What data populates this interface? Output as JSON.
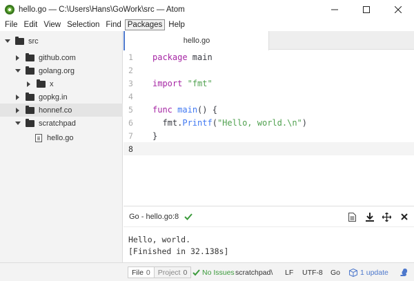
{
  "window": {
    "title": "hello.go — C:\\Users\\Hans\\GoWork\\src — Atom",
    "minimize_label": "—",
    "maximize_label": "☐",
    "close_label": "✕"
  },
  "menu": [
    "File",
    "Edit",
    "View",
    "Selection",
    "Find",
    "Packages",
    "Help"
  ],
  "tree": {
    "root": "src",
    "items": [
      "github.com",
      "golang.org",
      "x",
      "gopkg.in",
      "honnef.co",
      "scratchpad",
      "hello.go"
    ]
  },
  "editor": {
    "tab_label": "hello.go",
    "line_numbers": [
      "1",
      "2",
      "3",
      "4",
      "5",
      "6",
      "7",
      "8"
    ],
    "code": {
      "l1_kw": "package",
      "l1_rest": " main",
      "l3_kw": "import",
      "l3_str": "\"fmt\"",
      "l5_kw": "func",
      "l5_fn": "main",
      "l5_rest": "() {",
      "l6_pre": "  fmt.",
      "l6_fn": "Printf",
      "l6_open": "(",
      "l6_str": "\"Hello, world.\\n\"",
      "l6_close": ")",
      "l7": "}"
    },
    "current_line": 8
  },
  "panel": {
    "title": "Go - hello.go:8",
    "output": [
      "Hello, world.",
      "[Finished in 32.138s]"
    ]
  },
  "statusbar": {
    "file_tab": "File",
    "file_count": "0",
    "project_tab": "Project",
    "project_count": "0",
    "issues": "No Issues",
    "path": "scratchpad\\",
    "line_ending": "LF",
    "encoding": "UTF-8",
    "grammar": "Go",
    "update": "1 update"
  },
  "colors": {
    "keyword": "#a626a4",
    "string": "#50a14f",
    "function": "#4078f2",
    "accent": "#4d78cc",
    "success": "#3a9a3a"
  }
}
